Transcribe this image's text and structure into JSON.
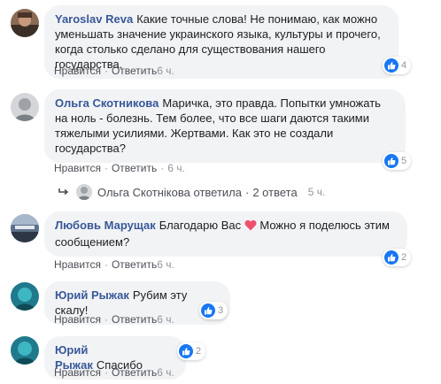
{
  "comments": [
    {
      "author": "Yaroslav Reva",
      "text": "Какие точные слова! Не понимаю, как можно уменьшать значение украинского языка, культуры и прочего, когда столько сделано для существования нашего государства.",
      "like": "Нравится",
      "reply": "Ответить",
      "time": "6 ч.",
      "reactions": "4"
    },
    {
      "author": "Ольга Скотникова",
      "text": "Маричка, это правда. Попытки умножать на ноль - болезнь. Тем более, что все шаги даются такими тяжелыми усилиями. Жертвами. Как это не создали государства?",
      "like": "Нравится",
      "reply": "Ответить",
      "time": "6 ч.",
      "reactions": "5"
    },
    {
      "author": "Любовь Марущак",
      "text_before": "Благодарю Вас",
      "text_after": "Можно я поделюсь этим сообщением?",
      "like": "Нравится",
      "reply": "Ответить",
      "time": "6 ч.",
      "reactions": "2"
    },
    {
      "author": "Юрий Рыжак",
      "text": "Рубим эту скалу!",
      "like": "Нравится",
      "reply": "Ответить",
      "time": "6 ч.",
      "reactions": "3"
    },
    {
      "author": "Юрий Рыжак",
      "text": "Спасибо",
      "like": "Нравится",
      "reply": "Ответить",
      "time": "6 ч.",
      "reactions": "2"
    }
  ],
  "reply_thread": {
    "author": "Ольга Скотнікова",
    "verb": "ответила",
    "count": "2 ответа",
    "time": "5 ч."
  },
  "colors": {
    "author": "#385898",
    "bubble": "#f2f3f5",
    "like_badge": "#1877f2",
    "heart": "#f0506e"
  }
}
